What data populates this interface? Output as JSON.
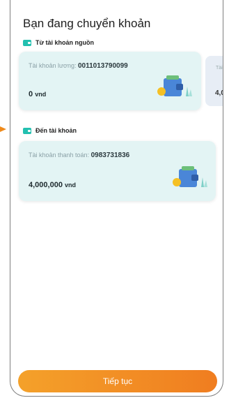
{
  "header": {
    "title": "Bạn đang chuyển khoản"
  },
  "from_section": {
    "label": "Từ tài khoản nguồn",
    "account_label": "Tài khoản lương: ",
    "account_number": "0011013790099",
    "balance_value": "0",
    "balance_unit": "vnd",
    "peek_card_label": "Tài",
    "peek_card_value": "4,0"
  },
  "to_section": {
    "label": "Đến tài khoản",
    "account_label": "Tài khoản thanh toán: ",
    "account_number": "0983731836",
    "balance_value": "4,000,000",
    "balance_unit": "vnd"
  },
  "actions": {
    "continue_label": "Tiếp tục"
  },
  "colors": {
    "accent": "#f08a20",
    "card_bg": "#e3f4f4",
    "icon": "#23c0b0"
  }
}
